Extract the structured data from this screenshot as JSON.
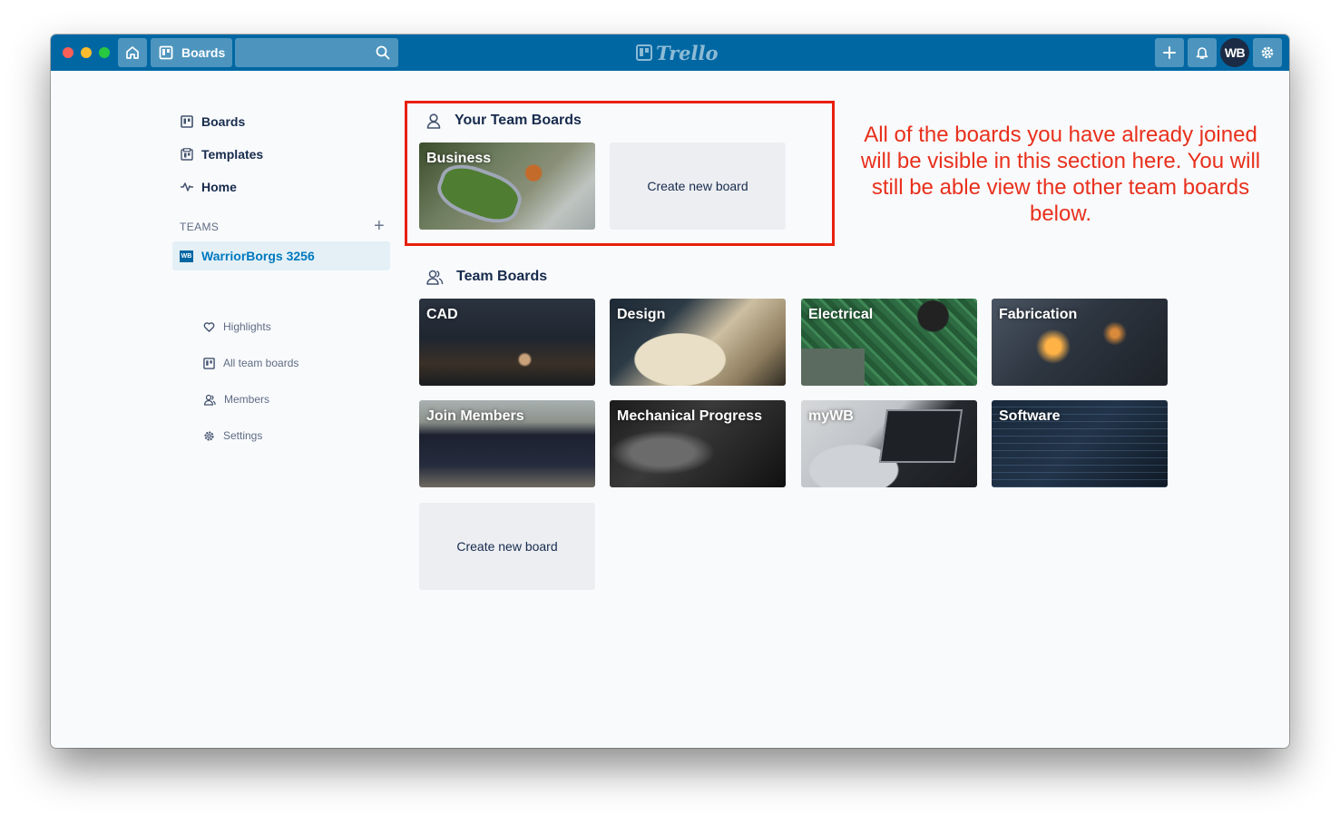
{
  "topbar": {
    "boards_label": "Boards",
    "logo_text": "Trello",
    "avatar_initials": "WB"
  },
  "sidebar": {
    "items": [
      {
        "label": "Boards",
        "icon": "board-icon"
      },
      {
        "label": "Templates",
        "icon": "templates-icon"
      },
      {
        "label": "Home",
        "icon": "activity-icon"
      }
    ],
    "teams_header": "TEAMS",
    "team_name": "WarriorBorgs 3256",
    "team_logo": "WB",
    "team_sub_items": [
      {
        "label": "Highlights",
        "icon": "heart-icon"
      },
      {
        "label": "All team boards",
        "icon": "board-icon"
      },
      {
        "label": "Members",
        "icon": "members-icon"
      },
      {
        "label": "Settings",
        "icon": "gear-icon"
      }
    ]
  },
  "your_team_boards": {
    "title": "Your Team Boards",
    "boards": [
      "Business"
    ],
    "create_label": "Create new board"
  },
  "team_boards": {
    "title": "Team Boards",
    "boards": [
      "CAD",
      "Design",
      "Electrical",
      "Fabrication",
      "Join Members",
      "Mechanical Progress",
      "myWB",
      "Software"
    ],
    "create_label": "Create new board"
  },
  "annotation": {
    "text": "All of the boards you have already joined will be visible in this section here. You will still be able view the other team boards below.",
    "color": "#e8301c"
  },
  "colors": {
    "topbar": "#0067a3",
    "accent": "#0079bf",
    "highlight_border": "#e8200c"
  }
}
